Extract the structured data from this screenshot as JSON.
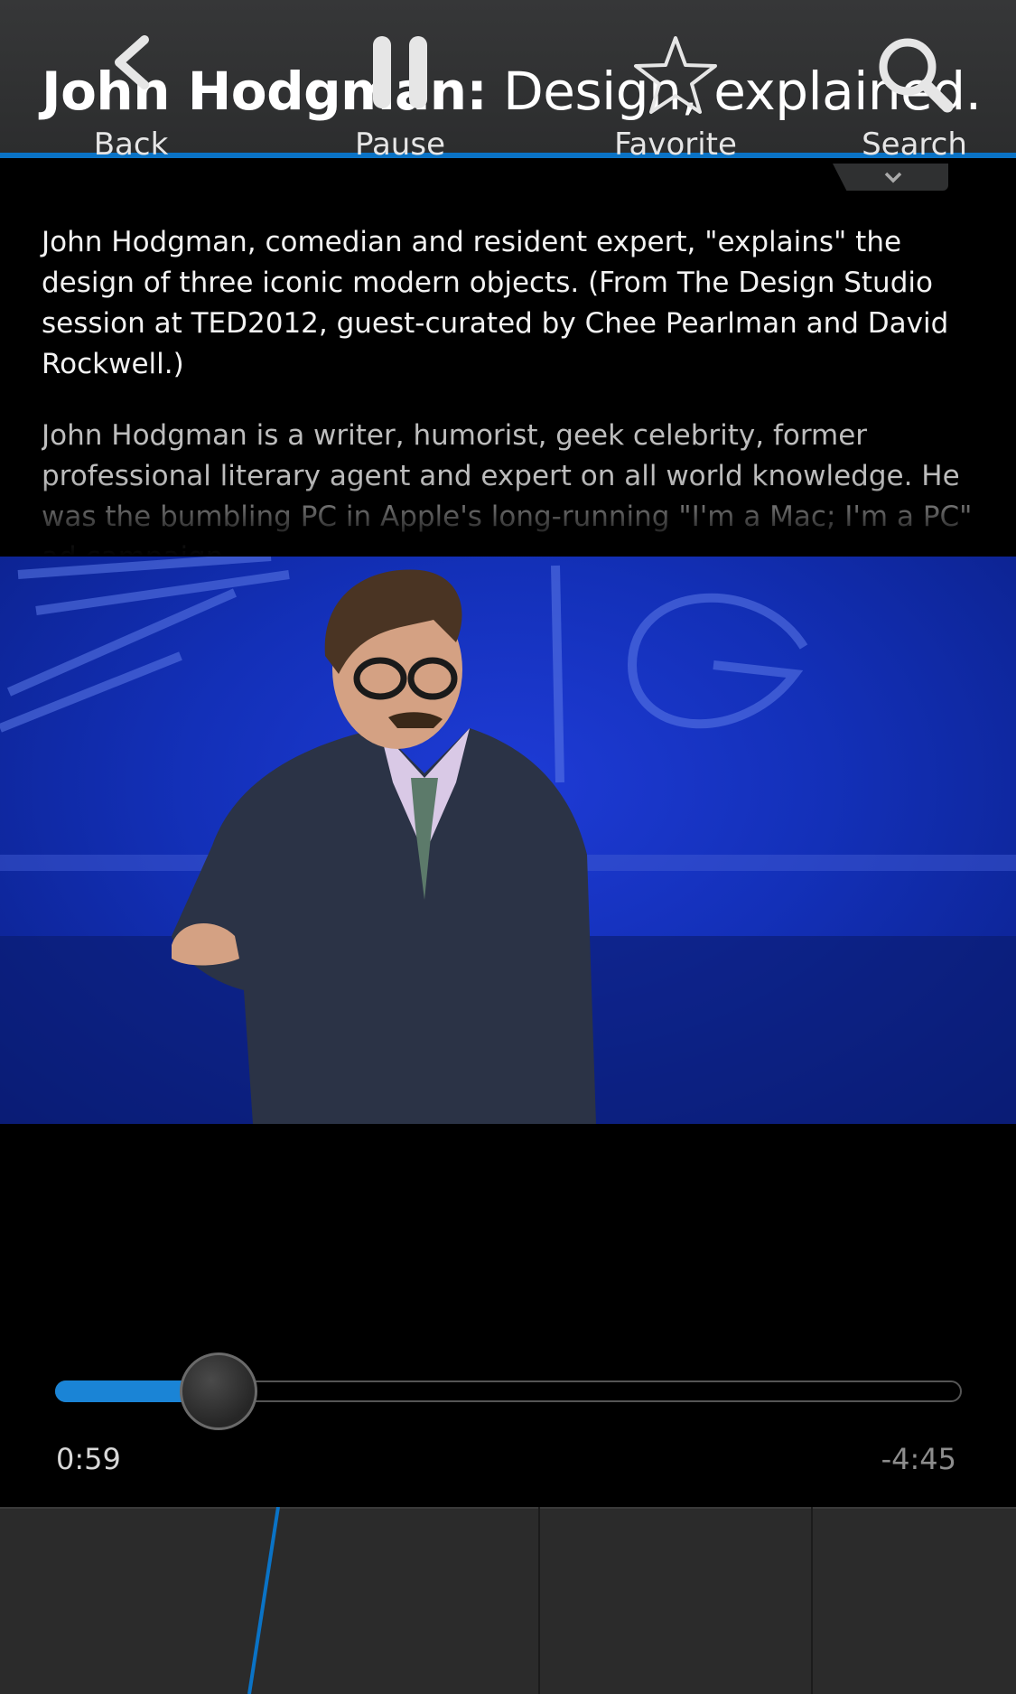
{
  "header": {
    "speaker": "John Hodgman:",
    "talk_title": " Design, explained."
  },
  "description": {
    "summary": "John Hodgman, comedian and resident expert, \"explains\" the design of three iconic modern objects. (From The Design Studio session at TED2012, guest-curated by Chee Pearlman and David Rockwell.)",
    "bio": "John Hodgman is a writer, humorist, geek celebrity, former professional literary agent and expert on all world knowledge. He was the bumbling PC in Apple's long-running \"I'm a Mac; I'm a PC\" ad campaign."
  },
  "player": {
    "elapsed": "0:59",
    "remaining": "-4:45",
    "progress": 0.18
  },
  "actions": {
    "back": "Back",
    "pause": "Pause",
    "favorite": "Favorite",
    "search": "Search"
  },
  "colors": {
    "accent": "#0a73c6",
    "progress": "#1a84d6"
  }
}
